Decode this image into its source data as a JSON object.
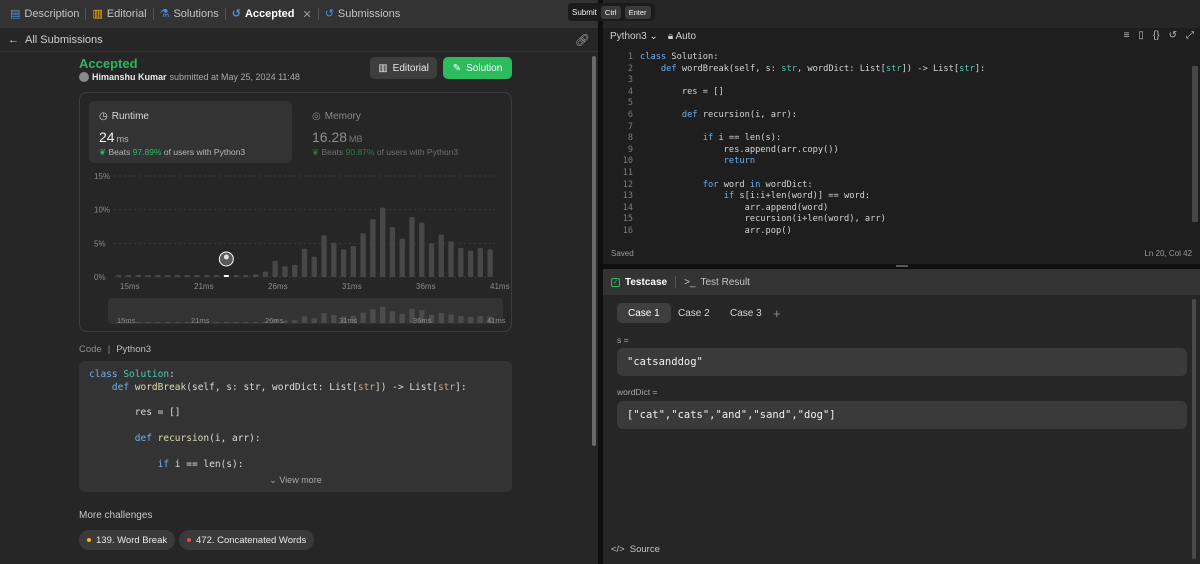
{
  "tabs": [
    {
      "label": "Description",
      "icon": "description-icon"
    },
    {
      "label": "Editorial",
      "icon": "book-icon"
    },
    {
      "label": "Solutions",
      "icon": "flask-icon"
    },
    {
      "label": "Accepted",
      "icon": "history-icon",
      "active": true
    },
    {
      "label": "Submissions",
      "icon": "history-icon"
    }
  ],
  "submit_tip": {
    "label": "Submit",
    "key1": "Ctrl",
    "key2": "Enter"
  },
  "subheader": {
    "back_label": "All Submissions"
  },
  "result": {
    "status": "Accepted",
    "author": "Himanshu Kumar",
    "submitted_text": "submitted at May 25, 2024 11:48",
    "editorial_button": "Editorial",
    "solution_button": "Solution"
  },
  "runtime": {
    "label": "Runtime",
    "value": "24",
    "unit": "ms",
    "beats_prefix": "Beats",
    "beats_pct": "97.89%",
    "beats_suffix": "of users with Python3"
  },
  "memory": {
    "label": "Memory",
    "value": "16.28",
    "unit": "MB",
    "beats_prefix": "Beats",
    "beats_pct": "90.87%",
    "beats_suffix": "of users with Python3"
  },
  "chart_data": {
    "type": "bar",
    "y_ticks": [
      "15%",
      "10%",
      "5%",
      "0%"
    ],
    "ylim": [
      0,
      15
    ],
    "x_ticks": [
      "15ms",
      "21ms",
      "26ms",
      "31ms",
      "36ms",
      "41ms"
    ],
    "values": [
      0.3,
      0.3,
      0.3,
      0.3,
      0.3,
      0.3,
      0.3,
      0.3,
      0.3,
      0.3,
      0.3,
      0.3,
      0.3,
      0.3,
      0.4,
      0.8,
      2.4,
      1.6,
      1.8,
      4.2,
      3.0,
      6.2,
      5.1,
      4.1,
      4.6,
      6.5,
      8.6,
      10.3,
      7.4,
      5.7,
      8.9,
      8.1,
      5.0,
      6.3,
      5.3,
      4.3,
      3.9,
      4.3,
      4.1
    ],
    "highlight_index": 11,
    "colors": {
      "bar": "#474747",
      "highlight": "#ffffff"
    }
  },
  "code_section": {
    "label": "Code",
    "language": "Python3",
    "view_more": "View more",
    "lines": [
      [
        "class ",
        "Solution",
        ":"
      ],
      [
        "    def ",
        "wordBreak",
        "(self, s: str, wordDict: List[",
        "str",
        "]) -> List[",
        "str",
        "]:"
      ],
      [
        ""
      ],
      [
        "        res = []"
      ],
      [
        ""
      ],
      [
        "        def ",
        "recursion",
        "(i, arr):"
      ],
      [
        ""
      ],
      [
        "            if ",
        "i == len(s):"
      ]
    ]
  },
  "more_challenges": {
    "title": "More challenges",
    "items": [
      {
        "label": "139. Word Break",
        "color": "#ffb800"
      },
      {
        "label": "472. Concatenated Words",
        "color": "#ef4743"
      }
    ]
  },
  "editor": {
    "language": "Python3",
    "mode": "Auto",
    "status": "Saved",
    "position": "Ln 20, Col 42",
    "line_numbers": [
      "1",
      "2",
      "3",
      "4",
      "5",
      "6",
      "7",
      "8",
      "9",
      "10",
      "11",
      "12",
      "13",
      "14",
      "15",
      "16"
    ],
    "code_lines": [
      "class Solution:",
      "    def wordBreak(self, s: str, wordDict: List[str]) -> List[str]:",
      "",
      "        res = []",
      "",
      "        def recursion(i, arr):",
      "",
      "            if i == len(s):",
      "                res.append(arr.copy())",
      "                return",
      "",
      "            for word in wordDict:",
      "                if s[i:i+len(word)] == word:",
      "                    arr.append(word)",
      "                    recursion(i+len(word), arr)",
      "                    arr.pop()"
    ]
  },
  "testcase": {
    "tab_label": "Testcase",
    "result_label": "Test Result",
    "cases": [
      "Case 1",
      "Case 2",
      "Case 3"
    ],
    "add_label": "+",
    "vars": [
      {
        "name": "s =",
        "value": "\"catsanddog\""
      },
      {
        "name": "wordDict =",
        "value": "[\"cat\",\"cats\",\"and\",\"sand\",\"dog\"]"
      }
    ],
    "source_label": "Source"
  }
}
